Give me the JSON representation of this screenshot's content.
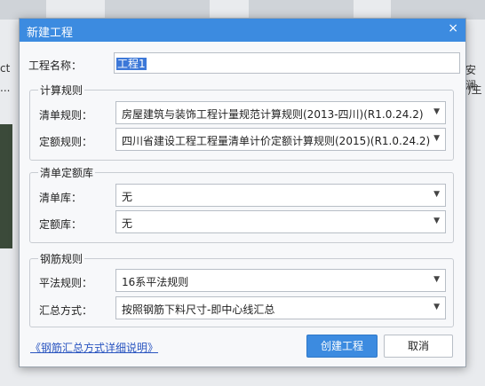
{
  "background": {
    "right_text_1": "安澜",
    "right_text_2": ")主",
    "left_text_1": "ct",
    "left_text_2": "..."
  },
  "dialog": {
    "title": "新建工程",
    "close_glyph": "×",
    "project_name": {
      "label": "工程名称：",
      "value": "工程1"
    },
    "groups": {
      "calc_rules": {
        "legend": "计算规则",
        "list_rule_label": "清单规则：",
        "list_rule_value": "房屋建筑与装饰工程计量规范计算规则(2013-四川)(R1.0.24.2)",
        "quota_rule_label": "定额规则：",
        "quota_rule_value": "四川省建设工程工程量清单计价定额计算规则(2015)(R1.0.24.2)"
      },
      "libraries": {
        "legend": "清单定额库",
        "list_lib_label": "清单库：",
        "list_lib_value": "无",
        "quota_lib_label": "定额库：",
        "quota_lib_value": "无"
      },
      "rebar": {
        "legend": "钢筋规则",
        "plan_rule_label": "平法规则：",
        "plan_rule_value": "16系平法规则",
        "summary_label": "汇总方式：",
        "summary_value": "按照钢筋下料尺寸-即中心线汇总"
      }
    },
    "help_link": "《钢筋汇总方式详细说明》",
    "create_button": "创建工程",
    "cancel_button": "取消",
    "dropdown_arrow": "▼"
  }
}
